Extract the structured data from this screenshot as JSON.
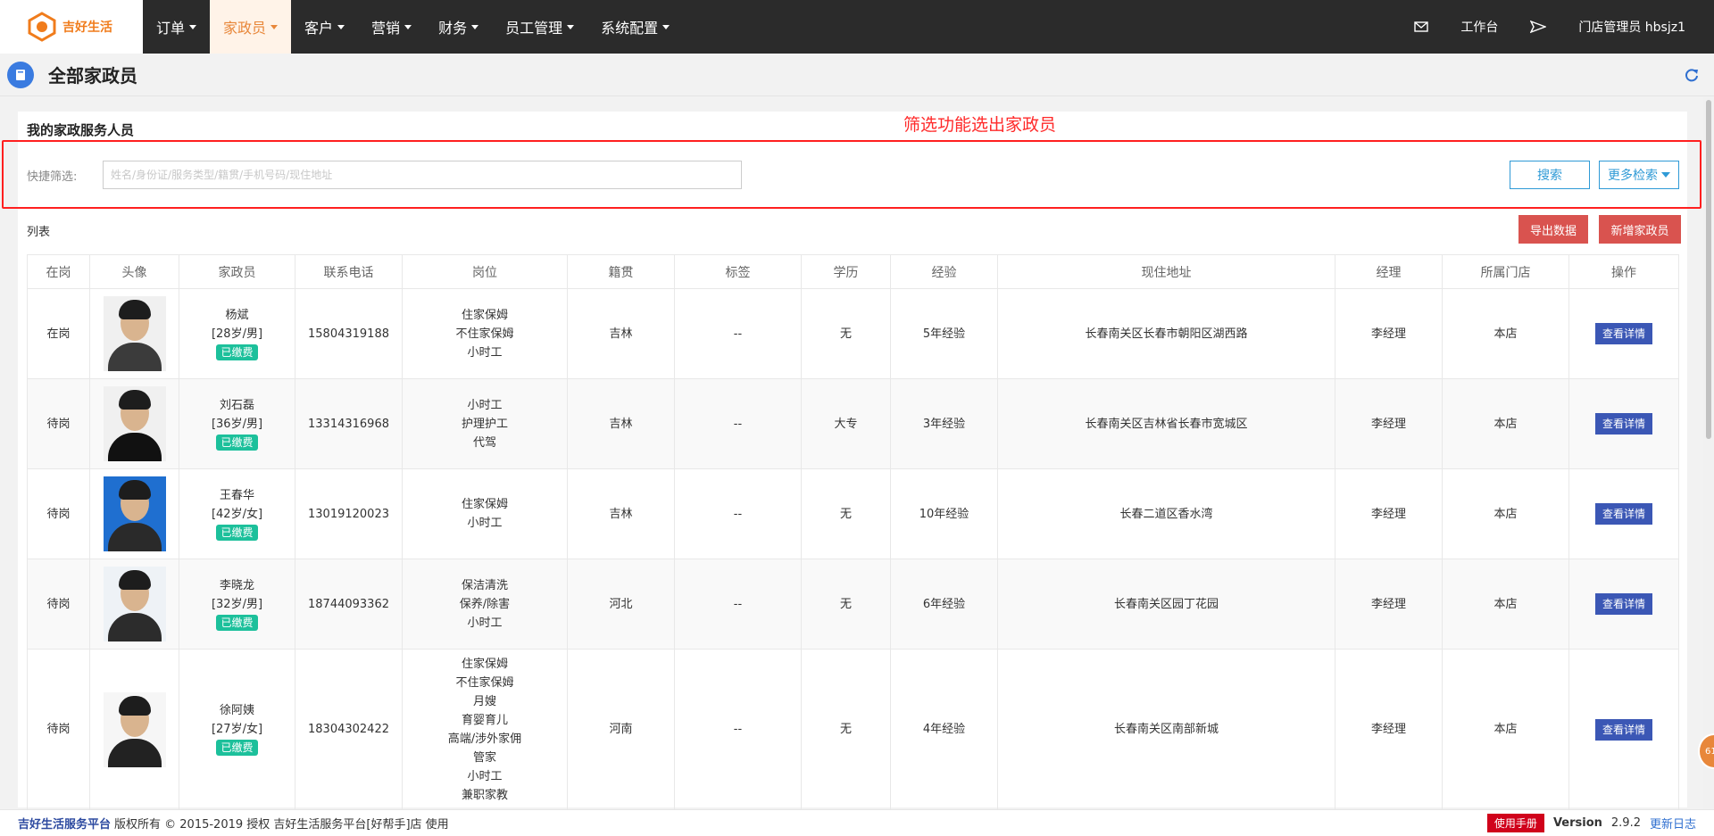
{
  "brand": {
    "name": "吉好生活"
  },
  "nav": [
    {
      "label": "订单"
    },
    {
      "label": "家政员"
    },
    {
      "label": "客户"
    },
    {
      "label": "营销"
    },
    {
      "label": "财务"
    },
    {
      "label": "员工管理"
    },
    {
      "label": "系统配置"
    }
  ],
  "header_right": {
    "workbench": "工作台",
    "user": "门店管理员 hbsjz1"
  },
  "page": {
    "title": "全部家政员"
  },
  "card": {
    "title": "我的家政服务人员",
    "annotation": "筛选功能选出家政员",
    "filter_label": "快捷筛选:",
    "filter_placeholder": "姓名/身份证/服务类型/籍贯/手机号码/现住地址",
    "filter_value": "",
    "search_label": "搜索",
    "more_label": "更多检索",
    "list_label": "列表",
    "export_label": "导出数据",
    "add_label": "新增家政员"
  },
  "table": {
    "headers": [
      "在岗",
      "头像",
      "家政员",
      "联系电话",
      "岗位",
      "籍贯",
      "标签",
      "学历",
      "经验",
      "现住地址",
      "经理",
      "所属门店",
      "操作"
    ],
    "rows": [
      {
        "status": "在岗",
        "name": "杨斌",
        "info": "[28岁/男]",
        "badge": "已缴费",
        "phone": "15804319188",
        "positions": [
          "住家保姆",
          "不住家保姆",
          "小时工"
        ],
        "native": "吉林",
        "tag": "--",
        "edu": "无",
        "exp": "5年经验",
        "address": "长春南关区长春市朝阳区湖西路",
        "manager": "李经理",
        "store": "本店",
        "action": "查看详情"
      },
      {
        "status": "待岗",
        "name": "刘石磊",
        "info": "[36岁/男]",
        "badge": "已缴费",
        "phone": "13314316968",
        "positions": [
          "小时工",
          "护理护工",
          "代驾"
        ],
        "native": "吉林",
        "tag": "--",
        "edu": "大专",
        "exp": "3年经验",
        "address": "长春南关区吉林省长春市宽城区",
        "manager": "李经理",
        "store": "本店",
        "action": "查看详情"
      },
      {
        "status": "待岗",
        "name": "王春华",
        "info": "[42岁/女]",
        "badge": "已缴费",
        "phone": "13019120023",
        "positions": [
          "住家保姆",
          "小时工"
        ],
        "native": "吉林",
        "tag": "--",
        "edu": "无",
        "exp": "10年经验",
        "address": "长春二道区香水湾",
        "manager": "李经理",
        "store": "本店",
        "action": "查看详情"
      },
      {
        "status": "待岗",
        "name": "李晓龙",
        "info": "[32岁/男]",
        "badge": "已缴费",
        "phone": "18744093362",
        "positions": [
          "保洁清洗",
          "保养/除害",
          "小时工"
        ],
        "native": "河北",
        "tag": "--",
        "edu": "无",
        "exp": "6年经验",
        "address": "长春南关区园丁花园",
        "manager": "李经理",
        "store": "本店",
        "action": "查看详情"
      },
      {
        "status": "待岗",
        "name": "徐阿姨",
        "info": "[27岁/女]",
        "badge": "已缴费",
        "phone": "18304302422",
        "positions": [
          "住家保姆",
          "不住家保姆",
          "月嫂",
          "育婴育儿",
          "高端/涉外家佣",
          "管家",
          "小时工",
          "兼职家教"
        ],
        "native": "河南",
        "tag": "--",
        "edu": "无",
        "exp": "4年经验",
        "address": "长春南关区南部新城",
        "manager": "李经理",
        "store": "本店",
        "action": "查看详情"
      }
    ]
  },
  "footer": {
    "brand": "吉好生活服务平台",
    "copyright": "版权所有 © 2015-2019 授权 吉好生活服务平台[好帮手]店 使用",
    "manual": "使用手册",
    "version_label": "Version",
    "version": "2.9.2",
    "changelog": "更新日志"
  },
  "float_badge": {
    "text": "61"
  }
}
